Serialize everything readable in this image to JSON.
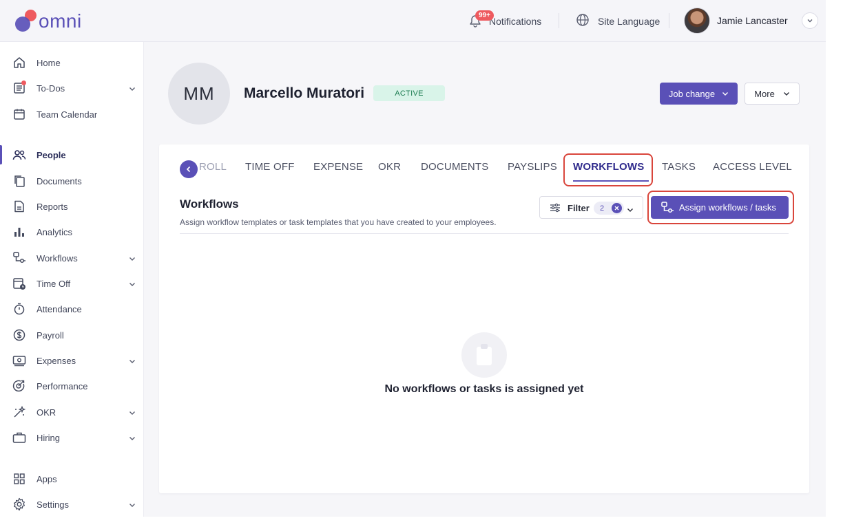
{
  "header": {
    "logo_text": "omni",
    "notifications_badge": "99+",
    "notifications_label": "Notifications",
    "language_label": "Site Language",
    "user_name": "Jamie Lancaster"
  },
  "sidebar": {
    "items": [
      {
        "label": "Home",
        "icon": "home-icon"
      },
      {
        "label": "To-Dos",
        "icon": "todo-icon",
        "has_chevron": true,
        "has_dot": true
      },
      {
        "label": "Team Calendar",
        "icon": "calendar-icon"
      },
      {
        "label": "People",
        "icon": "people-icon",
        "active": true
      },
      {
        "label": "Documents",
        "icon": "documents-icon"
      },
      {
        "label": "Reports",
        "icon": "reports-icon"
      },
      {
        "label": "Analytics",
        "icon": "analytics-icon"
      },
      {
        "label": "Workflows",
        "icon": "workflows-icon",
        "has_chevron": true
      },
      {
        "label": "Time Off",
        "icon": "time-off-icon",
        "has_chevron": true
      },
      {
        "label": "Attendance",
        "icon": "stopwatch-icon"
      },
      {
        "label": "Payroll",
        "icon": "dollar-icon"
      },
      {
        "label": "Expenses",
        "icon": "expenses-icon",
        "has_chevron": true
      },
      {
        "label": "Performance",
        "icon": "performance-icon"
      },
      {
        "label": "OKR",
        "icon": "okr-icon",
        "has_chevron": true
      },
      {
        "label": "Hiring",
        "icon": "briefcase-icon",
        "has_chevron": true
      },
      {
        "label": "Apps",
        "icon": "apps-icon"
      },
      {
        "label": "Settings",
        "icon": "gear-icon",
        "has_chevron": true
      }
    ]
  },
  "profile": {
    "initials": "MM",
    "name": "Marcello Muratori",
    "status": "ACTIVE",
    "job_change_label": "Job change",
    "more_label": "More"
  },
  "tabs": [
    {
      "label": "ROLL"
    },
    {
      "label": "TIME OFF"
    },
    {
      "label": "EXPENSE"
    },
    {
      "label": "OKR"
    },
    {
      "label": "DOCUMENTS"
    },
    {
      "label": "PAYSLIPS"
    },
    {
      "label": "WORKFLOWS",
      "active": true
    },
    {
      "label": "TASKS"
    },
    {
      "label": "ACCESS LEVEL"
    }
  ],
  "workflows": {
    "title": "Workflows",
    "subtitle": "Assign workflow templates or task templates that you have created to your employees.",
    "filter_label": "Filter",
    "filter_count": "2",
    "assign_label": "Assign workflows / tasks",
    "empty_text": "No workflows or tasks is assigned yet"
  },
  "colors": {
    "accent": "#5a50b7",
    "highlight": "#d9453b",
    "status_green": "#d9f4e9"
  }
}
